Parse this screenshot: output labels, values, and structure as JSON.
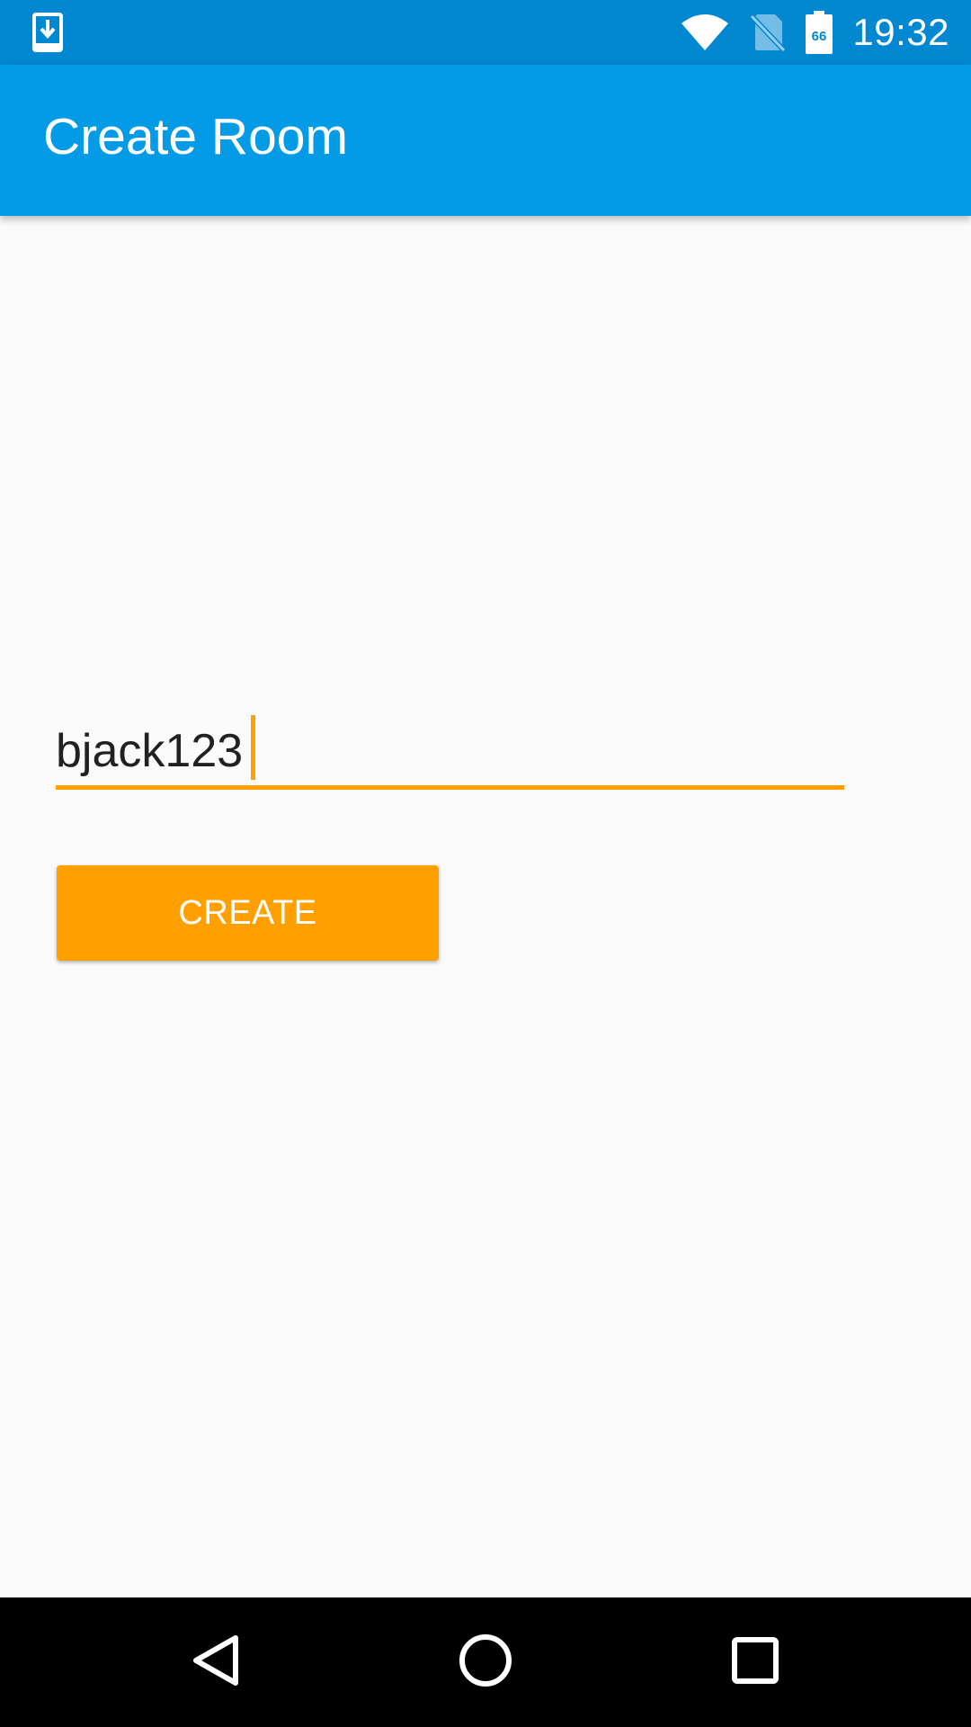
{
  "status_bar": {
    "time": "19:32",
    "battery_level": "66",
    "icons": [
      "download-notification-icon",
      "wifi-icon",
      "no-sim-icon",
      "battery-icon"
    ]
  },
  "app_bar": {
    "title": "Create Room"
  },
  "form": {
    "room_name_value": "bjack123",
    "create_label": "CREATE"
  },
  "nav_bar": {
    "icons": [
      "back-icon",
      "home-icon",
      "recents-icon"
    ]
  },
  "colors": {
    "status_bar": "#0288D1",
    "app_bar": "#039BE5",
    "accent": "#FFA000",
    "background": "#FAFAFA",
    "nav_bar": "#000000"
  }
}
